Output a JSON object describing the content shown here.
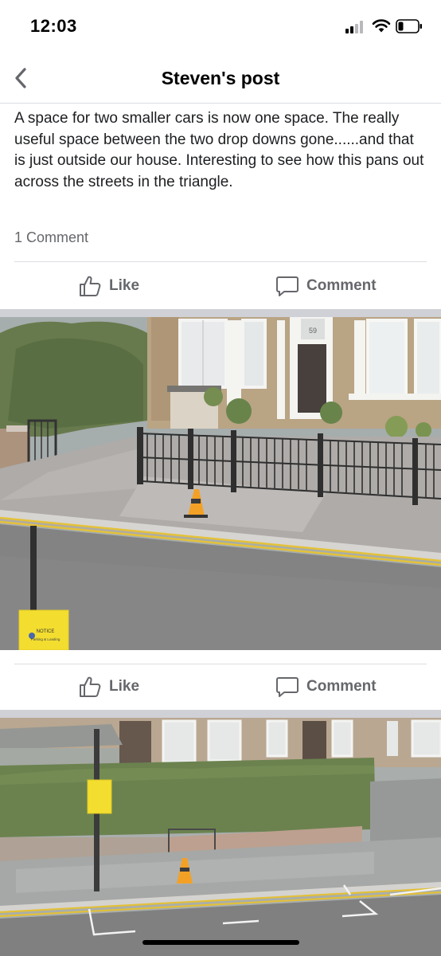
{
  "status_bar": {
    "time": "12:03",
    "icons": [
      "cellular-signal-icon",
      "wifi-icon",
      "battery-icon"
    ]
  },
  "header": {
    "title": "Steven's post",
    "back_icon": "chevron-left-icon"
  },
  "post": {
    "text": "A space for two smaller cars is now one space.  The really useful space between the two drop downs gone......and that is just outside our house. Interesting to see how this pans out across the streets in the triangle.",
    "comment_count": "1 Comment"
  },
  "actions": {
    "like_label": "Like",
    "comment_label": "Comment",
    "like_icon": "thumbs-up-icon",
    "comment_icon": "speech-bubble-icon"
  },
  "photos": [
    {
      "house_number": "59",
      "sign_text": "NOTICE",
      "sign_subtext": "Parking & Loading"
    },
    {
      "sign_text": "",
      "sign_subtext": ""
    }
  ],
  "colors": {
    "secondary_text": "#65676b",
    "divider": "#dadde1",
    "section_gap": "#cfd1d6",
    "sign_yellow": "#f2dc1e",
    "cone_orange": "#f29a14"
  }
}
